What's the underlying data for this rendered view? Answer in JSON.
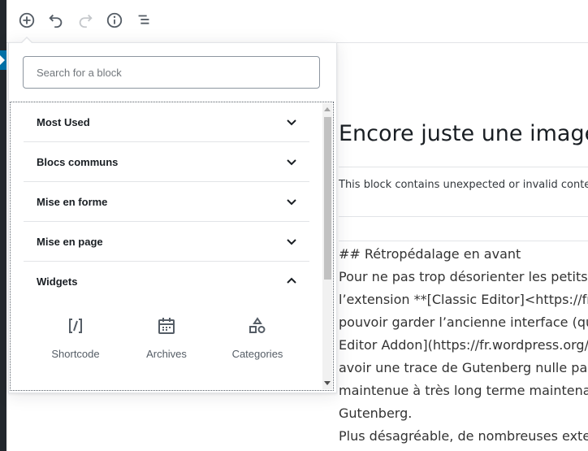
{
  "toolbar": {
    "add_block_icon": "plus-circle-icon",
    "undo_icon": "undo-icon",
    "redo_icon": "redo-icon",
    "info_icon": "info-icon",
    "outline_icon": "list-icon"
  },
  "inserter": {
    "search_placeholder": "Search for a block",
    "panels": [
      {
        "title": "Most Used",
        "expanded": false
      },
      {
        "title": "Blocs communs",
        "expanded": false
      },
      {
        "title": "Mise en forme",
        "expanded": false
      },
      {
        "title": "Mise en page",
        "expanded": false
      },
      {
        "title": "Widgets",
        "expanded": true
      }
    ],
    "widget_items": [
      {
        "label": "Shortcode",
        "icon": "shortcode-icon"
      },
      {
        "label": "Archives",
        "icon": "calendar-icon"
      },
      {
        "label": "Categories",
        "icon": "categories-icon"
      }
    ]
  },
  "editor": {
    "post_title": "Encore juste une image",
    "invalid_warning": "This block contains unexpected or invalid content.",
    "body_lines": [
      "## Rétropédalage en avant",
      "Pour ne pas trop désorienter les petits vie",
      "l’extension **[Classic Editor]<https://fr.wor",
      "pouvoir garder l’ancienne interface (que v",
      "Editor Addon](https://fr.wordpress.org/plu",
      "avoir une trace de Gutenberg nulle part) m",
      "maintenue à très long terme maintenant c",
      "Gutenberg.",
      "Plus désagréable, de nombreuses extensi"
    ]
  },
  "colors": {
    "admin_bar": "#23282d",
    "accent": "#0073aa",
    "border": "#e2e4e7"
  }
}
